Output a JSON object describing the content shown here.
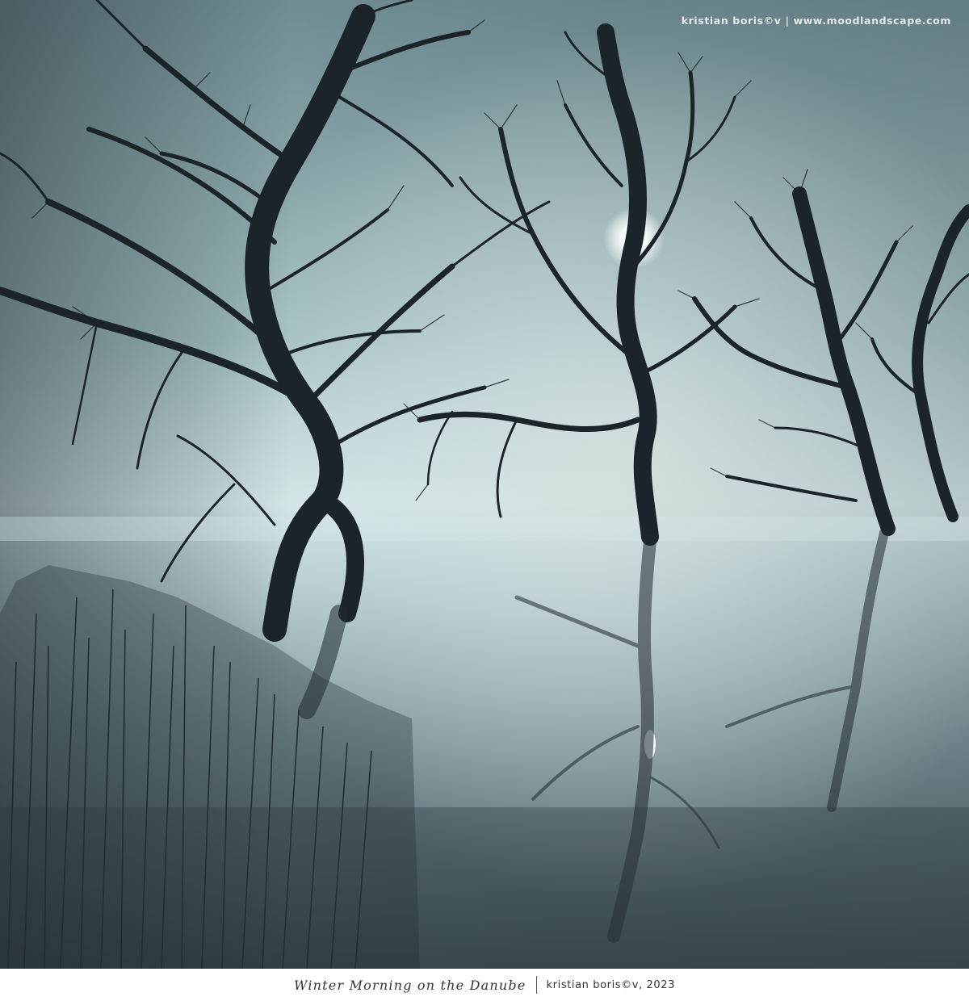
{
  "photo": {
    "watermark": "kristian boris©v | www.moodlandscape.com"
  },
  "caption": {
    "title": "Winter Morning on the Danube",
    "credit": "kristian boris©v, 2023"
  },
  "colors": {
    "sky_light": "#cfe3e3",
    "sky_mid": "#8fb0b2",
    "water_dark": "#3c4f56",
    "tree_silhouette": "#1b2428",
    "sun": "#ffffff"
  }
}
